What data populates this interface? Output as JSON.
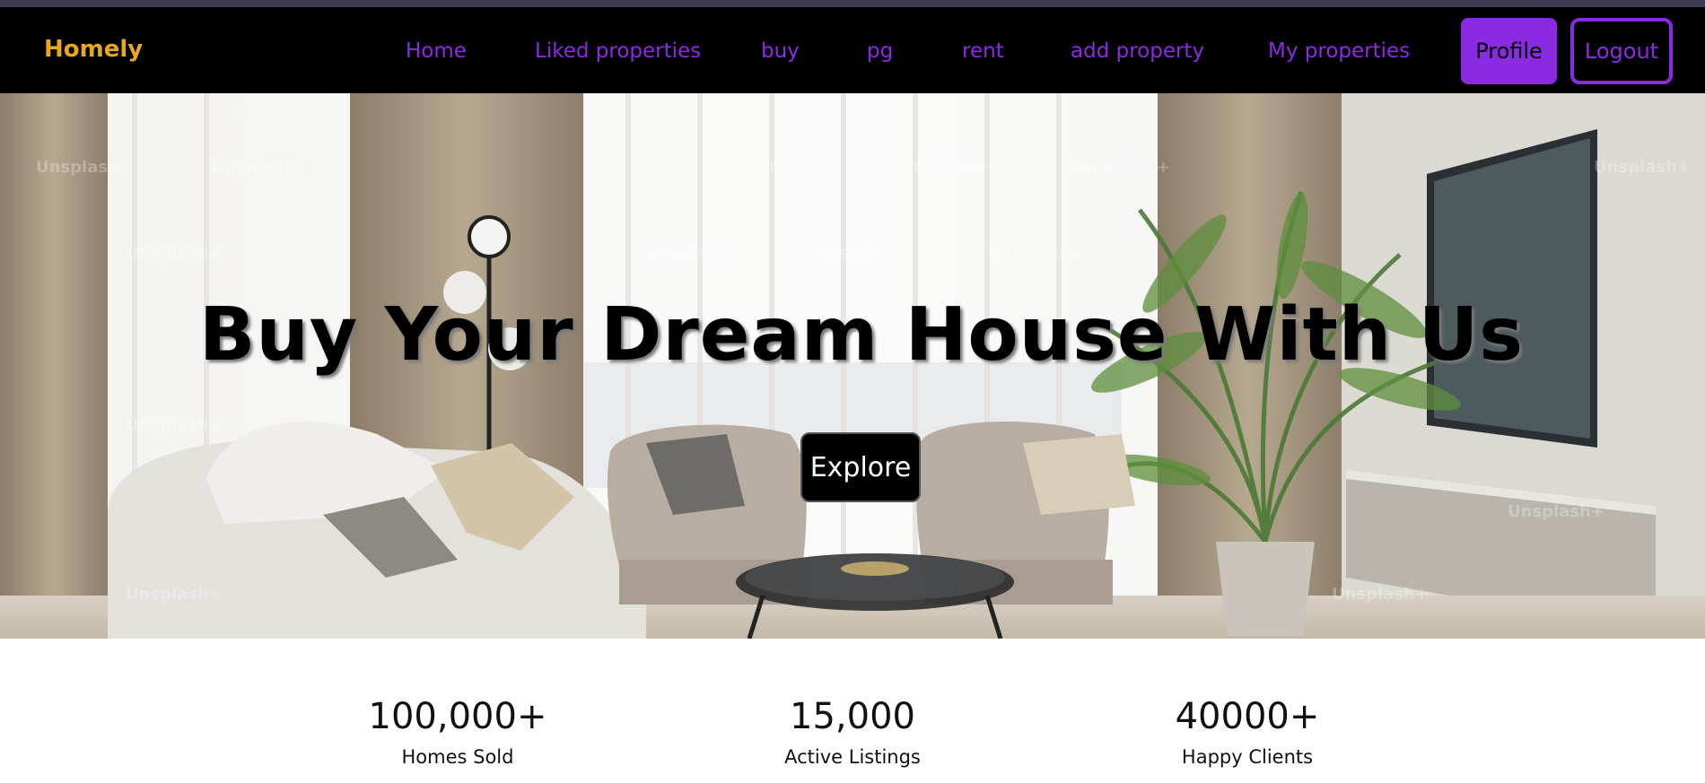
{
  "navbar": {
    "brand": "Homely",
    "links": [
      {
        "label": "Home"
      },
      {
        "label": "Liked properties"
      },
      {
        "label": "buy"
      },
      {
        "label": "pg"
      },
      {
        "label": "rent"
      },
      {
        "label": "add property"
      },
      {
        "label": "My properties"
      }
    ],
    "profile_label": "Profile",
    "logout_label": "Logout"
  },
  "hero": {
    "heading": "Buy Your Dream House With Us",
    "cta_label": "Explore",
    "watermark_text": "Unsplash+"
  },
  "stats": [
    {
      "value": "100,000+",
      "label": "Homes Sold"
    },
    {
      "value": "15,000",
      "label": "Active Listings"
    },
    {
      "value": "40000+",
      "label": "Happy Clients"
    }
  ],
  "colors": {
    "accent": "#8a2be2",
    "brand": "#e6a81c",
    "nav_background": "#000000"
  }
}
